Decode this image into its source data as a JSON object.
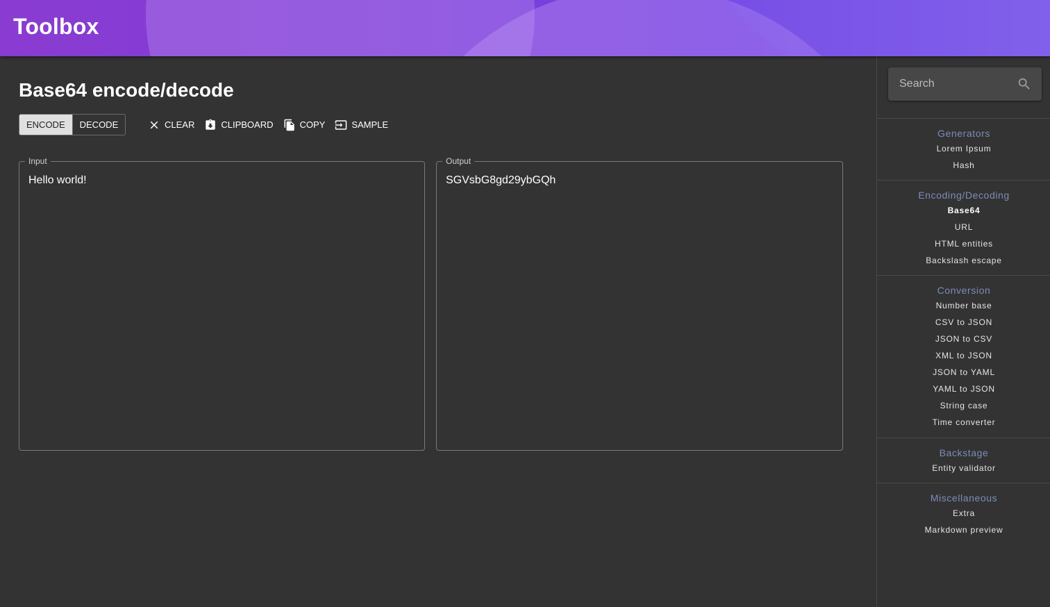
{
  "app": {
    "title": "Toolbox"
  },
  "page": {
    "title": "Base64 encode/decode"
  },
  "modes": {
    "encode": "ENCODE",
    "decode": "DECODE",
    "selected": "ENCODE"
  },
  "actions": {
    "clear": "CLEAR",
    "clipboard": "CLIPBOARD",
    "copy": "COPY",
    "sample": "SAMPLE"
  },
  "input": {
    "label": "Input",
    "value": "Hello world!"
  },
  "output": {
    "label": "Output",
    "value": "SGVsbG8gd29ybGQh"
  },
  "search": {
    "placeholder": "Search"
  },
  "sidebar": {
    "active_item": "Base64",
    "sections": [
      {
        "heading": "Generators",
        "items": [
          "Lorem Ipsum",
          "Hash"
        ]
      },
      {
        "heading": "Encoding/Decoding",
        "items": [
          "Base64",
          "URL",
          "HTML entities",
          "Backslash escape"
        ]
      },
      {
        "heading": "Conversion",
        "items": [
          "Number base",
          "CSV to JSON",
          "JSON to CSV",
          "XML to JSON",
          "JSON to YAML",
          "YAML to JSON",
          "String case",
          "Time converter"
        ]
      },
      {
        "heading": "Backstage",
        "items": [
          "Entity validator"
        ]
      },
      {
        "heading": "Miscellaneous",
        "items": [
          "Extra",
          "Markdown preview"
        ]
      }
    ]
  },
  "colors": {
    "header_start": "#8a3bd1",
    "header_end": "#7b5be8",
    "background": "#333333",
    "section_heading": "#7c8db8"
  },
  "icons": {
    "clear": "close-icon",
    "clipboard": "paste-icon",
    "copy": "copy-icon",
    "sample": "sample-icon",
    "search": "search-icon"
  }
}
